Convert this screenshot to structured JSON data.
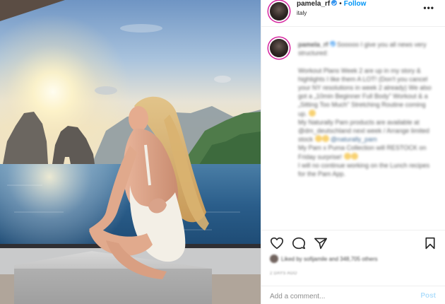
{
  "post": {
    "username": "pamela_rf",
    "follow_label": "Follow",
    "separator": "•",
    "location": "italy",
    "more_label": "•••"
  },
  "caption": {
    "username": "pamela_rf",
    "lines": [
      "Sooooo I give you all news very structured:",
      "Workout Plans Week 2 are up in my story & highlights I like them A LOT! (Don't you cancel your NY resolutions in week 2 already) We also got a „10min Beginner Full Body\" Workout & a „Sitting Too Much\" Stretching Routine coming up.",
      "My Naturally Pam products are available at @dm_deutschland next week / Arrange limited stock",
      "My Pam x Puma Collection will RESTOCK on Friday surprise!",
      "I will no continue working on the Lunch recipes for the Pam App."
    ],
    "link_text": "@dm_deutschland",
    "mention": "@naturally_pam"
  },
  "actions": {
    "like_icon": "heart-icon",
    "comment_icon": "speech-bubble-icon",
    "share_icon": "paper-plane-icon",
    "save_icon": "bookmark-icon"
  },
  "likes": {
    "text": "Liked by sofijamile and 348,705 others"
  },
  "time_ago": "2 DAYS AGO",
  "comment_box": {
    "placeholder": "Add a comment...",
    "post_label": "Post"
  },
  "colors": {
    "accent": "#0095f6",
    "verified": "#3897f0",
    "post_disabled": "#b2dffc",
    "story_ring": "#d6249f"
  }
}
